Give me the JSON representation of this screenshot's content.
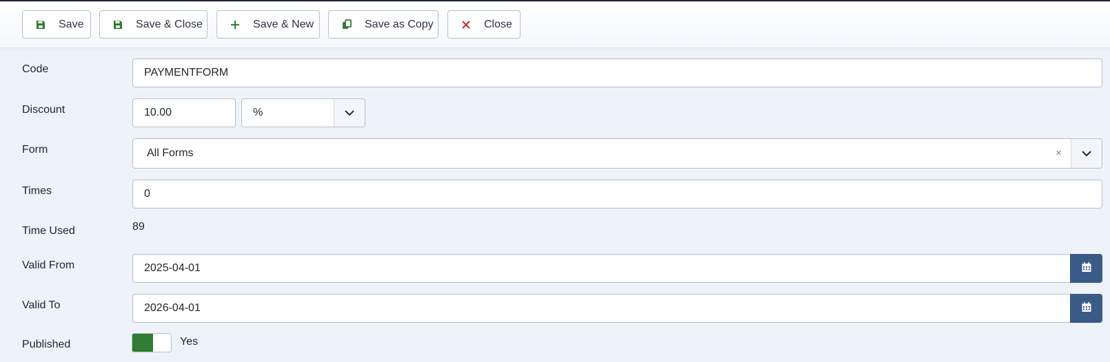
{
  "toolbar": {
    "save_label": "Save",
    "save_close_label": "Save & Close",
    "save_new_label": "Save & New",
    "save_copy_label": "Save as Copy",
    "close_label": "Close"
  },
  "colors": {
    "save_icon": "#2f7d32",
    "close_icon": "#c62828",
    "calendar_button": "#3a5a87",
    "switch_on": "#2f7d32"
  },
  "form": {
    "code": {
      "label": "Code",
      "value": "PAYMENTFORM"
    },
    "discount": {
      "label": "Discount",
      "value": "10.00",
      "type_selected": "%"
    },
    "form_select": {
      "label": "Form",
      "selected": "All Forms",
      "clear": "×"
    },
    "times": {
      "label": "Times",
      "value": "0"
    },
    "time_used": {
      "label": "Time Used",
      "value": "89"
    },
    "valid_from": {
      "label": "Valid From",
      "value": "2025-04-01"
    },
    "valid_to": {
      "label": "Valid To",
      "value": "2026-04-01"
    },
    "published": {
      "label": "Published",
      "state_label": "Yes",
      "on": true
    }
  },
  "icons": {
    "save": "floppy-disk-icon",
    "plus": "plus-icon",
    "copy": "copy-icon",
    "close": "close-icon",
    "chevron": "chevron-down-icon",
    "calendar": "calendar-icon"
  }
}
